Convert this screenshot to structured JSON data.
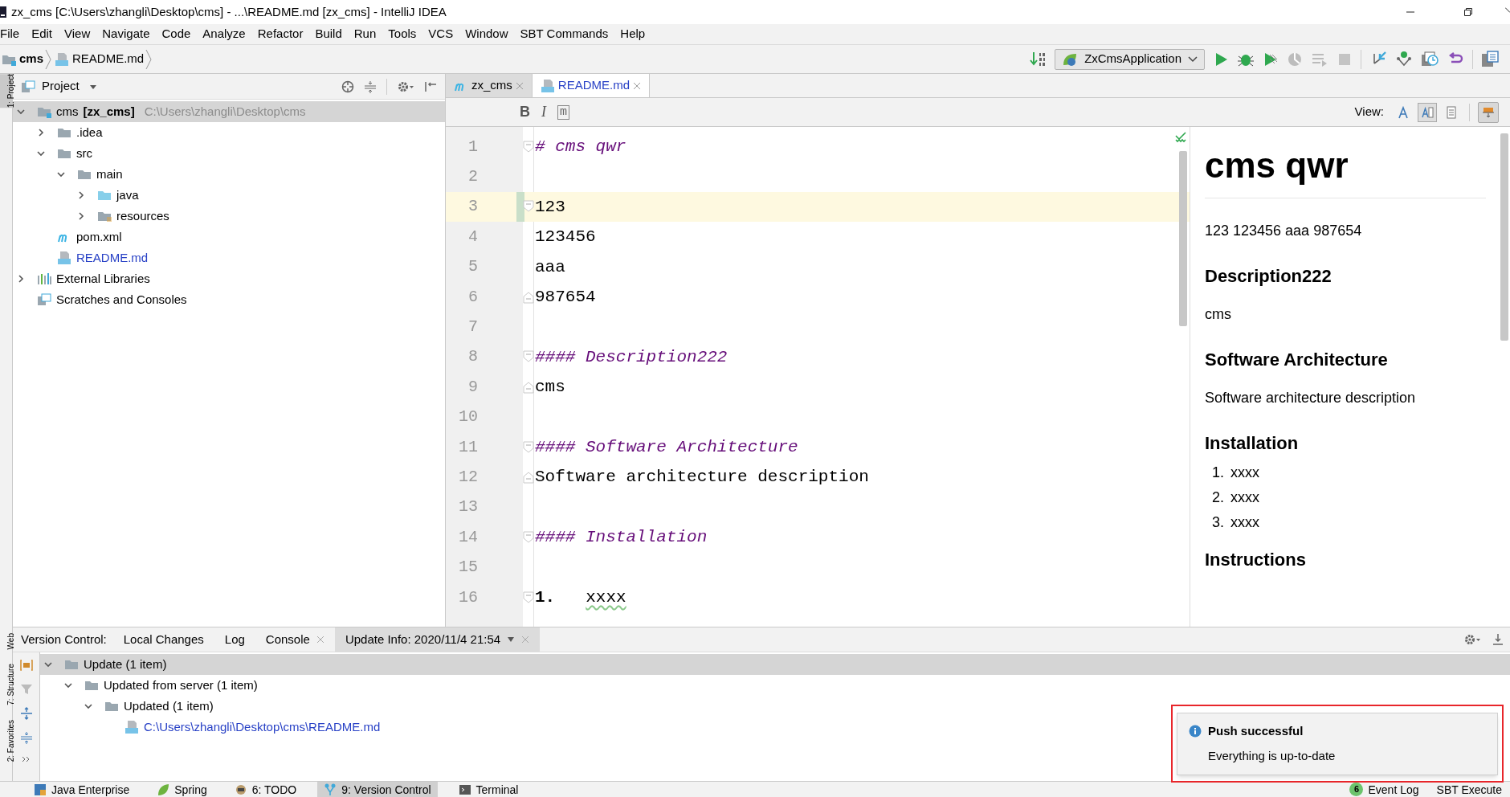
{
  "window": {
    "title": "zx_cms [C:\\Users\\zhangli\\Desktop\\cms] - ...\\README.md [zx_cms] - IntelliJ IDEA"
  },
  "menu": [
    "File",
    "Edit",
    "View",
    "Navigate",
    "Code",
    "Analyze",
    "Refactor",
    "Build",
    "Run",
    "Tools",
    "VCS",
    "Window",
    "SBT Commands",
    "Help"
  ],
  "breadcrumb": [
    {
      "label": "cms",
      "kind": "folder"
    },
    {
      "label": "README.md",
      "kind": "md"
    }
  ],
  "run_config": {
    "label": "ZxCmsApplication"
  },
  "side_tabs": [
    {
      "label": "1: Project",
      "selected": true
    },
    {
      "label": "Web",
      "selected": false
    },
    {
      "label": "7: Structure",
      "selected": false
    },
    {
      "label": "2: Favorites",
      "selected": false
    }
  ],
  "project": {
    "title": "Project",
    "tree": [
      {
        "label": "cms",
        "module": "[zx_cms]",
        "path": "C:\\Users\\zhangli\\Desktop\\cms",
        "kind": "module",
        "expanded": true,
        "selected": true,
        "modified": false,
        "children": [
          {
            "label": ".idea",
            "kind": "folder",
            "expanded": false,
            "selected": false,
            "modified": false
          },
          {
            "label": "src",
            "kind": "folder",
            "expanded": true,
            "selected": false,
            "modified": false,
            "children": [
              {
                "label": "main",
                "kind": "folder",
                "expanded": true,
                "selected": false,
                "modified": false,
                "children": [
                  {
                    "label": "java",
                    "kind": "source",
                    "expanded": false,
                    "selected": false,
                    "modified": false
                  },
                  {
                    "label": "resources",
                    "kind": "resources",
                    "expanded": false,
                    "selected": false,
                    "modified": false
                  }
                ]
              }
            ]
          },
          {
            "label": "pom.xml",
            "kind": "maven",
            "selected": false,
            "modified": false
          },
          {
            "label": "README.md",
            "kind": "md",
            "selected": false,
            "modified": true
          }
        ]
      },
      {
        "label": "External Libraries",
        "kind": "libraries",
        "expanded": false,
        "selected": false,
        "modified": false
      },
      {
        "label": "Scratches and Consoles",
        "kind": "scratches",
        "selected": false,
        "modified": false
      }
    ]
  },
  "editor_tabs": [
    {
      "label": "zx_cms",
      "kind": "maven",
      "selected": false,
      "modified": false
    },
    {
      "label": "README.md",
      "kind": "md",
      "selected": true,
      "modified": true
    }
  ],
  "md_toolbar": [
    {
      "label": "B",
      "kind": "bold"
    },
    {
      "label": "I",
      "kind": "italic"
    },
    {
      "label": "m",
      "kind": "code"
    }
  ],
  "view": {
    "label": "View:",
    "modes": [
      {
        "kind": "editor",
        "selected": false
      },
      {
        "kind": "split",
        "selected": true
      },
      {
        "kind": "preview",
        "selected": false
      }
    ],
    "layout_toggle": {
      "selected": true
    }
  },
  "lines": [
    {
      "number": "1",
      "kind": "heading",
      "text": "# cms qwr",
      "fold_start": true,
      "fold_end": false,
      "selected": false,
      "changed": false
    },
    {
      "number": "2",
      "kind": "text",
      "fold_start": false,
      "fold_end": false,
      "selected": false,
      "changed": false
    },
    {
      "number": "3",
      "kind": "text",
      "text": "123",
      "fold_start": true,
      "fold_end": false,
      "selected": true,
      "changed": true
    },
    {
      "number": "4",
      "kind": "text",
      "text": "123456",
      "fold_start": false,
      "fold_end": false,
      "selected": false,
      "changed": false
    },
    {
      "number": "5",
      "kind": "text",
      "text": "aaa",
      "fold_start": false,
      "fold_end": false,
      "selected": false,
      "changed": false
    },
    {
      "number": "6",
      "kind": "text",
      "text": "987654",
      "fold_start": false,
      "fold_end": true,
      "selected": false,
      "changed": false
    },
    {
      "number": "7",
      "kind": "text",
      "fold_start": false,
      "fold_end": false,
      "selected": false,
      "changed": false
    },
    {
      "number": "8",
      "kind": "heading",
      "text": "#### Description222",
      "fold_start": true,
      "fold_end": false,
      "selected": false,
      "changed": false
    },
    {
      "number": "9",
      "kind": "text",
      "text": "cms",
      "fold_start": false,
      "fold_end": true,
      "selected": false,
      "changed": false
    },
    {
      "number": "10",
      "kind": "text",
      "fold_start": false,
      "fold_end": false,
      "selected": false,
      "changed": false
    },
    {
      "number": "11",
      "kind": "heading",
      "text": "#### Software Architecture",
      "fold_start": true,
      "fold_end": false,
      "selected": false,
      "changed": false
    },
    {
      "number": "12",
      "kind": "text",
      "text": "Software architecture description",
      "fold_start": false,
      "fold_end": true,
      "selected": false,
      "changed": false
    },
    {
      "number": "13",
      "kind": "text",
      "fold_start": false,
      "fold_end": false,
      "selected": false,
      "changed": false
    },
    {
      "number": "14",
      "kind": "heading",
      "text": "#### Installation",
      "fold_start": true,
      "fold_end": false,
      "selected": false,
      "changed": false
    },
    {
      "number": "15",
      "kind": "text",
      "fold_start": false,
      "fold_end": false,
      "selected": false,
      "changed": false
    },
    {
      "number": "16",
      "kind": "list",
      "marker": "1.",
      "text": "xxxx",
      "fold_start": true,
      "fold_end": false,
      "selected": false,
      "changed": false
    }
  ],
  "preview": [
    {
      "kind": "h1",
      "text": "cms qwr"
    },
    {
      "kind": "p",
      "text": "123 123456 aaa 987654"
    },
    {
      "kind": "h4",
      "text": "Description222"
    },
    {
      "kind": "p",
      "text": "cms"
    },
    {
      "kind": "h4",
      "text": "Software Architecture"
    },
    {
      "kind": "p",
      "text": "Software architecture description"
    },
    {
      "kind": "h4",
      "text": "Installation"
    },
    {
      "kind": "li",
      "marker": "1.",
      "text": "xxxx"
    },
    {
      "kind": "li",
      "marker": "2.",
      "text": "xxxx"
    },
    {
      "kind": "li",
      "marker": "3.",
      "text": "xxxx"
    },
    {
      "kind": "h4",
      "text": "Instructions"
    }
  ],
  "tool_window": {
    "title": "Version Control:",
    "tabs": [
      {
        "label": "Local Changes",
        "selected": false,
        "closable": false,
        "dropdown": false
      },
      {
        "label": "Log",
        "selected": false,
        "closable": false,
        "dropdown": false
      },
      {
        "label": "Console",
        "selected": false,
        "closable": true,
        "dropdown": false
      },
      {
        "label": "Update Info: 2020/11/4 21:54",
        "selected": true,
        "closable": true,
        "dropdown": true
      }
    ],
    "tree": [
      {
        "label": "Update (1 item)",
        "kind": "folder",
        "expanded": true,
        "selected": true,
        "modified": false,
        "children": [
          {
            "label": "Updated from server (1 item)",
            "kind": "folder",
            "expanded": true,
            "selected": false,
            "modified": false,
            "children": [
              {
                "label": "Updated (1 item)",
                "kind": "folder",
                "expanded": true,
                "selected": false,
                "modified": false,
                "children": [
                  {
                    "label": "C:\\Users\\zhangli\\Desktop\\cms\\README.md",
                    "kind": "md",
                    "selected": false,
                    "modified": true
                  }
                ]
              }
            ]
          }
        ]
      }
    ]
  },
  "notification": {
    "kind": "info",
    "title": "Push successful",
    "body": "Everything is up-to-date"
  },
  "status_bar": {
    "tools": [
      {
        "label": "Java Enterprise",
        "kind": "enterprise",
        "selected": false
      },
      {
        "label": "Spring",
        "kind": "leaf",
        "selected": false
      },
      {
        "label": "6: TODO",
        "kind": "todo",
        "selected": false
      },
      {
        "label": "9: Version Control",
        "kind": "vcs",
        "selected": true
      },
      {
        "label": "Terminal",
        "kind": "terminal",
        "selected": false
      }
    ],
    "right": [
      {
        "label": "Event Log",
        "badge": "6"
      },
      {
        "label": "SBT Execute"
      }
    ]
  }
}
